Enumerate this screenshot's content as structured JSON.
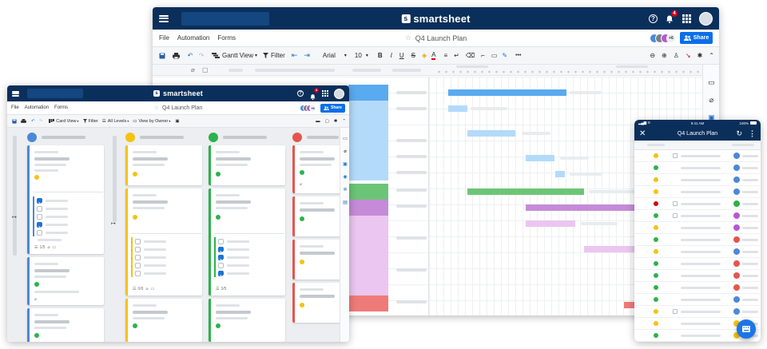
{
  "brand": {
    "name": "smartsheet",
    "logo_glyph": "s"
  },
  "sheet": {
    "title": "Q4 Launch Plan"
  },
  "menu": [
    "File",
    "Automation",
    "Forms"
  ],
  "share": {
    "label": "Share",
    "extra_count": "+6"
  },
  "notifications": {
    "count": "4"
  },
  "help_glyph": "?",
  "gantt_toolbar": {
    "view_label": "Gantt View",
    "filter_label": "Filter",
    "font_family": "Arial",
    "font_size": "10",
    "bold": "B",
    "italic": "I",
    "underline": "U",
    "strike": "S",
    "text_color": "A",
    "more": "•••"
  },
  "card_toolbar": {
    "view_label": "Card View",
    "filter_label": "Filter",
    "levels_label": "All Levels",
    "group_label": "View by Owner"
  },
  "card_footer_counts": {
    "lane1": "1/5",
    "lane2": "0/6",
    "lane3": "3/5"
  },
  "mobile": {
    "time": "9:41 AM",
    "battery": "100%",
    "title": "Q4 Launch Plan",
    "status_dots": [
      "#f5c211",
      "#2bb34a",
      "#f5c211",
      "#f5c211",
      "#d0021b",
      "#2bb34a",
      "#f5c211",
      "#2bb34a",
      "#f5c211",
      "#2bb34a",
      "#2bb34a",
      "#2bb34a",
      "#2bb34a",
      "#f5c211",
      "#f5c211",
      "#2bb34a"
    ],
    "avatar_colors": [
      "#4d88d8",
      "#4d88d8",
      "#4d88d8",
      "#4d88d8",
      "#2bb34a",
      "#b658d3",
      "#b658d3",
      "#e4564d",
      "#4d88d8",
      "#e4564d",
      "#e4564d",
      "#e4564d",
      "#4d88d8",
      "#4d88d8",
      "#f5c211",
      "#f5c211"
    ]
  },
  "colors": {
    "navy": "#0b2f5b",
    "accent": "#0b6fe8",
    "blue_bar": "#5aaaf0",
    "light_blue_bar": "#b4dafa",
    "green_bar": "#6cc576",
    "purple_bar": "#c58bd8",
    "light_purple_bar": "#ebc6f0",
    "red_bar": "#ef7b78"
  },
  "lane_colors": [
    "#4d88d8",
    "#b658d3",
    "#2bb34a",
    "#e4564d"
  ],
  "avatar_colors": [
    "#4d88d8",
    "#7a7f86",
    "#b658d3",
    "#2bb34a"
  ]
}
